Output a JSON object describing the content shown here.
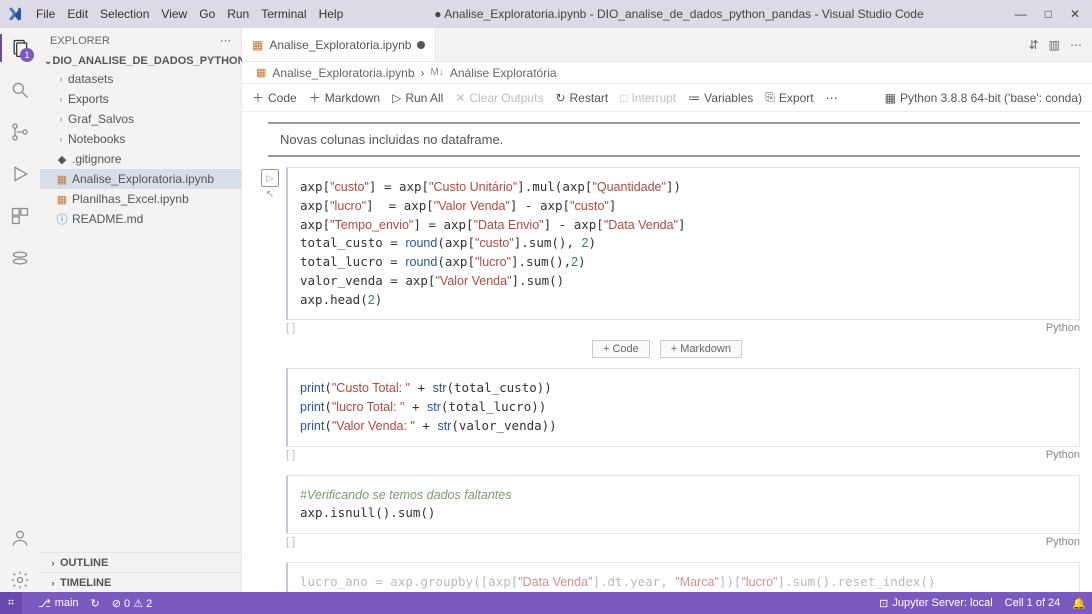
{
  "menubar": {
    "items": [
      "File",
      "Edit",
      "Selection",
      "View",
      "Go",
      "Run",
      "Terminal",
      "Help"
    ],
    "title": "● Analise_Exploratoria.ipynb - DIO_analise_de_dados_python_pandas - Visual Studio Code"
  },
  "sidebar": {
    "title": "EXPLORER",
    "section": "DIO_ANALISE_DE_DADOS_PYTHON_PANDAS",
    "tree": [
      {
        "type": "folder",
        "label": "datasets"
      },
      {
        "type": "folder",
        "label": "Exports"
      },
      {
        "type": "folder",
        "label": "Graf_Salvos"
      },
      {
        "type": "folder",
        "label": "Notebooks"
      },
      {
        "type": "file",
        "label": ".gitignore",
        "icon": "◆",
        "color": "#555"
      },
      {
        "type": "file",
        "label": "Analise_Exploratoria.ipynb",
        "icon": "▦",
        "color": "#c47a3a",
        "selected": true
      },
      {
        "type": "file",
        "label": "Planilhas_Excel.ipynb",
        "icon": "▦",
        "color": "#c47a3a"
      },
      {
        "type": "file",
        "label": "README.md",
        "icon": "ⓘ",
        "color": "#4a7ab8"
      }
    ],
    "outline": "OUTLINE",
    "timeline": "TIMELINE"
  },
  "tabs": {
    "active": {
      "label": "Analise_Exploratoria.ipynb",
      "dirty": true
    }
  },
  "breadcrumb": {
    "file": "Analise_Exploratoria.ipynb",
    "cell_prefix": "M↓",
    "cell": "Análise Exploratória"
  },
  "toolbar": {
    "code": "Code",
    "markdown": "Markdown",
    "runall": "Run All",
    "clear": "Clear Outputs",
    "restart": "Restart",
    "interrupt": "Interrupt",
    "variables": "Variables",
    "export": "Export",
    "kernel": "Python 3.8.8 64-bit ('base': conda)"
  },
  "markdown_cell": "Novas colunas incluidas no dataframe.",
  "cells": [
    {
      "lang": "Python"
    },
    {
      "lang": "Python"
    },
    {
      "lang": "Python"
    }
  ],
  "add_buttons": {
    "code": "+ Code",
    "markdown": "+ Markdown"
  },
  "statusbar": {
    "branch": "main",
    "sync": "↻",
    "errors": "⊘ 0 ⚠ 2",
    "jupyter": "Jupyter Server: local",
    "cellpos": "Cell 1 of 24",
    "bell": "🔔"
  },
  "activity_badge": "1"
}
